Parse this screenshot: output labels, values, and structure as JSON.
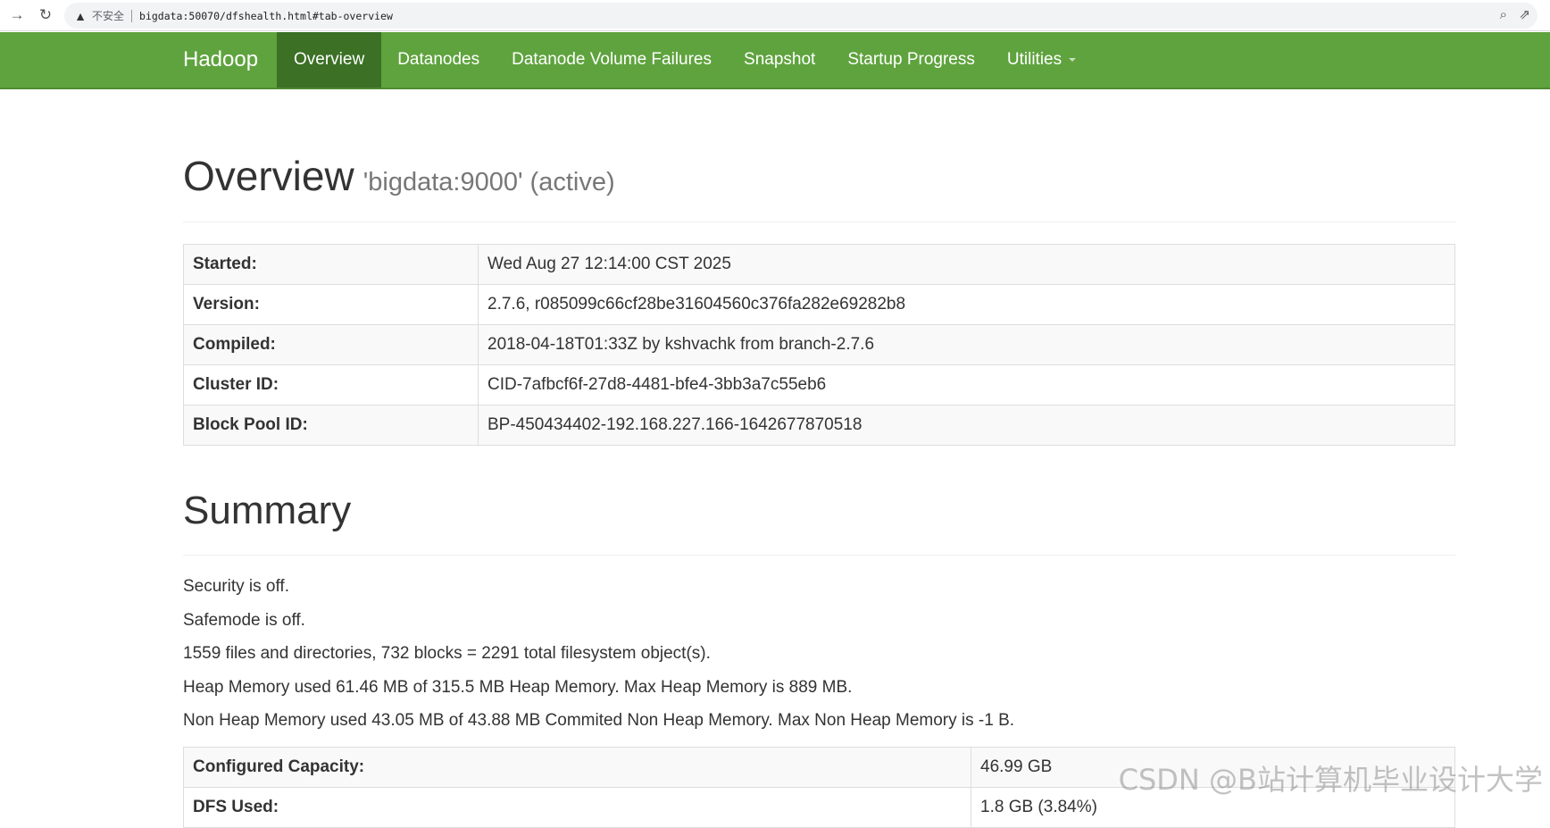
{
  "browser": {
    "security_label": "不安全",
    "url": "bigdata:50070/dfshealth.html#tab-overview"
  },
  "navbar": {
    "brand": "Hadoop",
    "items": [
      {
        "label": "Overview",
        "active": true
      },
      {
        "label": "Datanodes"
      },
      {
        "label": "Datanode Volume Failures"
      },
      {
        "label": "Snapshot"
      },
      {
        "label": "Startup Progress"
      },
      {
        "label": "Utilities",
        "dropdown": true
      }
    ]
  },
  "overview": {
    "title": "Overview",
    "subtitle": "'bigdata:9000' (active)",
    "rows": [
      {
        "key": "Started:",
        "value": "Wed Aug 27 12:14:00 CST 2025"
      },
      {
        "key": "Version:",
        "value": "2.7.6, r085099c66cf28be31604560c376fa282e69282b8"
      },
      {
        "key": "Compiled:",
        "value": "2018-04-18T01:33Z by kshvachk from branch-2.7.6"
      },
      {
        "key": "Cluster ID:",
        "value": "CID-7afbcf6f-27d8-4481-bfe4-3bb3a7c55eb6"
      },
      {
        "key": "Block Pool ID:",
        "value": "BP-450434402-192.168.227.166-1642677870518"
      }
    ]
  },
  "summary": {
    "title": "Summary",
    "lines": [
      "Security is off.",
      "Safemode is off.",
      "1559 files and directories, 732 blocks = 2291 total filesystem object(s).",
      "Heap Memory used 61.46 MB of 315.5 MB Heap Memory. Max Heap Memory is 889 MB.",
      "Non Heap Memory used 43.05 MB of 43.88 MB Commited Non Heap Memory. Max Non Heap Memory is -1 B."
    ],
    "capacity_rows": [
      {
        "key": "Configured Capacity:",
        "value": "46.99 GB"
      },
      {
        "key": "DFS Used:",
        "value": "1.8 GB (3.84%)"
      }
    ]
  },
  "watermark": "CSDN @B站计算机毕业设计大学"
}
